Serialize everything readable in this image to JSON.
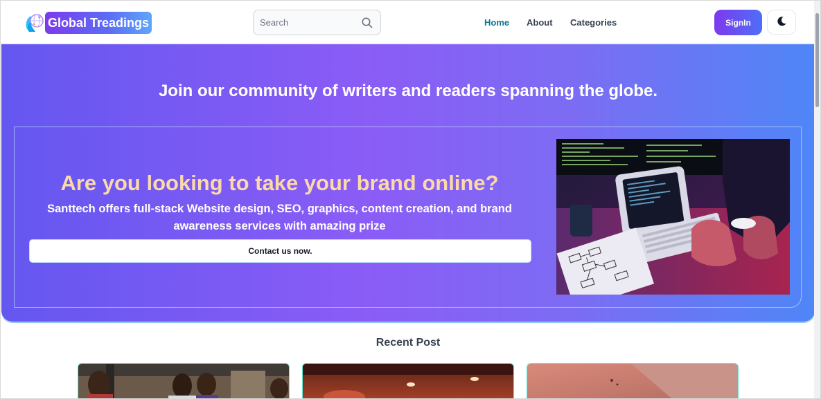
{
  "header": {
    "logo_text": "Global Treadings",
    "search_placeholder": "Search",
    "nav": [
      {
        "label": "Home",
        "active": true
      },
      {
        "label": "About",
        "active": false
      },
      {
        "label": "Categories",
        "active": false
      }
    ],
    "signin_label": "SignIn",
    "theme_icon": "moon-icon"
  },
  "hero": {
    "title": "Join our community of writers and readers spanning the globe.",
    "promo_heading": "Are you looking to take your brand online?",
    "promo_subtext": "Santtech offers full-stack Website design, SEO, graphics, content creation, and brand awareness services with amazing prize",
    "contact_label": "Contact us now."
  },
  "recent": {
    "title": "Recent Post"
  },
  "colors": {
    "accent_purple": "#7c3aed",
    "accent_blue": "#4f86f7",
    "promo_heading": "#fcd9a8",
    "nav_active": "#0e7490"
  }
}
